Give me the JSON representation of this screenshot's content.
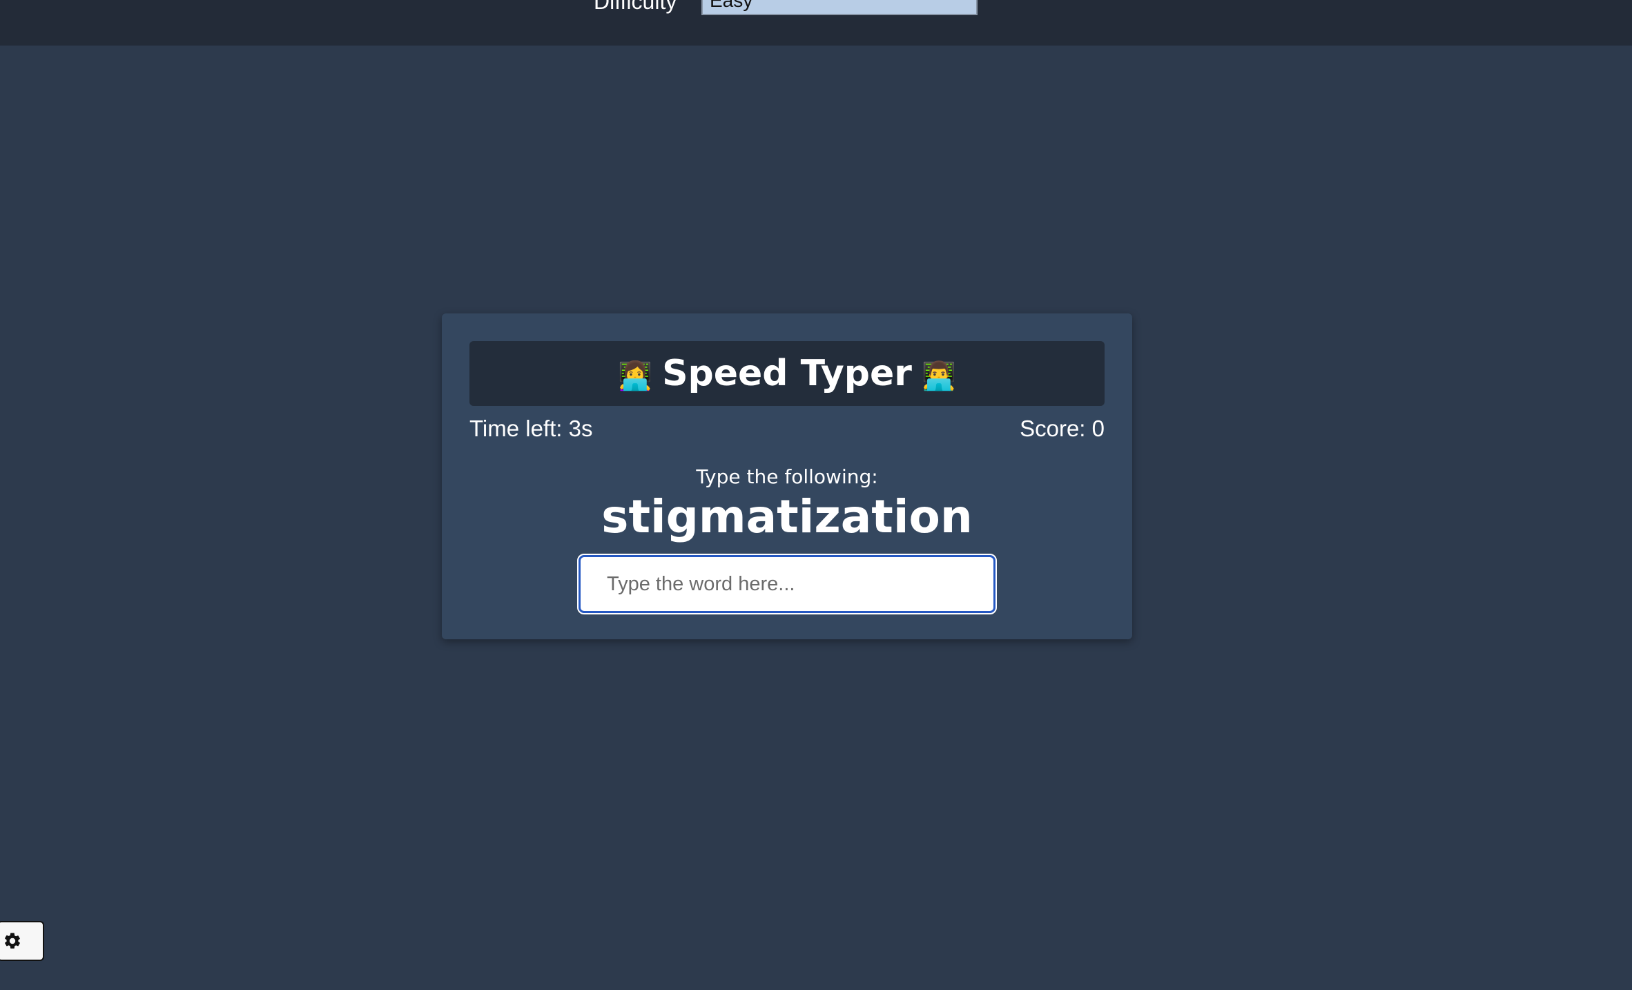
{
  "settings": {
    "difficulty_label": "Difficulty",
    "difficulty_selected": "Easy"
  },
  "game": {
    "title": "Speed Typer",
    "title_left_emoji": "👩‍💻",
    "title_right_emoji": "👨‍💻",
    "time_left": "Time left: 3s",
    "score": "Score: 0",
    "prompt_label": "Type the following:",
    "target_word": "stigmatization",
    "input_value": "",
    "input_placeholder": "Type the word here..."
  },
  "footer": {
    "settings_icon": "gear-icon"
  },
  "colors": {
    "background": "#2d3a4d",
    "settings_bar": "#232b38",
    "card": "#34475f",
    "title_bar": "#232d3b",
    "select_bg": "#b8cde6",
    "input_focus": "#2558c2"
  }
}
